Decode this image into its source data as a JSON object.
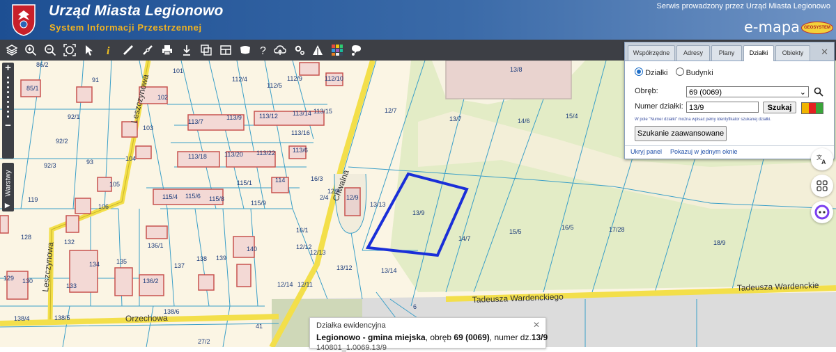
{
  "header": {
    "title": "Urząd Miasta Legionowo",
    "subtitle": "System Informacji Przestrzennej",
    "service_note": "Serwis prowadzony przez Urząd Miasta Legionowo",
    "brand": "e-mapa",
    "brand_badge": "GEOSYSTEM"
  },
  "colors": {
    "header": "#2a5b9e",
    "toolbar": "#3d3f45",
    "map_bg": "#fbf5e4",
    "parcel_line": "#3a9fc8",
    "road": "#f3df4a",
    "building": "#f3d9d5",
    "building_border": "#c8534f",
    "highlight": "#1a2fd8",
    "green_area": "#e3ecc6"
  },
  "toolbar": {
    "icons": [
      "layers-icon",
      "zoom-in-icon",
      "zoom-out-icon",
      "zoom-extent-icon",
      "select-arrow-icon",
      "info-icon",
      "measure-distance-icon",
      "measure-area-icon",
      "print-icon",
      "download-icon",
      "copy-map-icon",
      "layout-icon",
      "comment-icon",
      "help-icon",
      "cloud-upload-icon",
      "settings-icon",
      "street-view-icon",
      "color-palette-icon",
      "chat-icon"
    ]
  },
  "side_controls": {
    "zoom_in": "+",
    "zoom_out": "−",
    "layers_label": "Warstwy",
    "layers_arrow": "▶"
  },
  "search_panel": {
    "tabs": [
      {
        "label": "Współrzędne",
        "active": false
      },
      {
        "label": "Adresy",
        "active": false
      },
      {
        "label": "Plany",
        "active": false
      },
      {
        "label": "Działki",
        "active": true
      },
      {
        "label": "Obiekty",
        "active": false
      }
    ],
    "radio_parcels": "Działki",
    "radio_buildings": "Budynki",
    "obreb_label": "Obręb:",
    "obreb_value": "69 (0069)",
    "numer_label": "Numer działki:",
    "numer_value": "13/9",
    "search_button": "Szukaj",
    "hint": "W pole \"Numer działki\" można wpisać pełny identyfikator szukanej działki.",
    "advanced_button": "Szukanie zaawansowane",
    "link_hide": "Ukryj panel",
    "link_window": "Pokazuj w jednym oknie"
  },
  "popup": {
    "title": "Działka ewidencyjna",
    "location_bold": "Legionowo - gmina miejska",
    "detail_1": ", obręb ",
    "obreb_bold": "69 (0069)",
    "detail_2": ", numer dz.",
    "parcel_bold": "13/9",
    "id_line": "140801_1.0069.13/9"
  },
  "map": {
    "streets": [
      "Leszczynowa",
      "Leszczynowa",
      "Orzechowa",
      "Chwalna",
      "Tadeusza Wardenckiego",
      "Tadeusza Wardenckie"
    ],
    "parcel_labels": [
      "86/2",
      "91",
      "101",
      "112/4",
      "112/5",
      "112/9",
      "112/10",
      "113/7",
      "113/9",
      "113/12",
      "113/14",
      "113/15",
      "113/16",
      "113/20",
      "113/22",
      "113/6",
      "113/18",
      "115/1",
      "115/4",
      "115/6",
      "115/8",
      "115/9",
      "114",
      "16/3",
      "12/8",
      "2/4",
      "12/9",
      "13/13",
      "13/9",
      "13/8",
      "12/7",
      "13/7",
      "14/6",
      "15/4",
      "14/7",
      "15/5",
      "16/5",
      "17/28",
      "18/9",
      "16/1",
      "12/12",
      "12/13",
      "13/12",
      "13/14",
      "12/14",
      "12/11",
      "6",
      "41",
      "27/2",
      "85/1",
      "92/1",
      "92/2",
      "92/3",
      "93",
      "102",
      "103",
      "104",
      "105",
      "106",
      "119",
      "128",
      "132",
      "134",
      "135",
      "136/1",
      "136/2",
      "137",
      "138",
      "139",
      "140",
      "129",
      "130",
      "133",
      "138/4",
      "138/5",
      "138/6"
    ]
  }
}
